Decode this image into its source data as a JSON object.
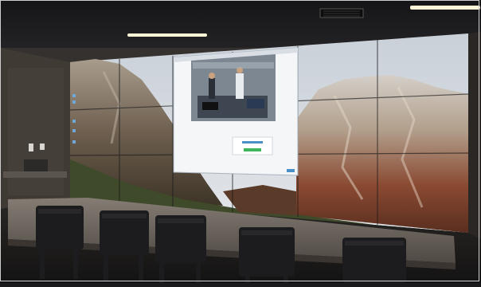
{
  "scene": {
    "subject": "control-room-video-wall",
    "colors": {
      "ceiling": "#1f1f22",
      "wall": "#3a3633",
      "sky": "#d7dde3",
      "rock_light": "#c9c3ba",
      "rock_red": "#8a4a32",
      "forest": "#3f4a2a",
      "panel_white": "#f4f6f8",
      "desk": "#6b655f",
      "chair": "#1c1c1e",
      "light_strip": "#fff6d8"
    }
  }
}
